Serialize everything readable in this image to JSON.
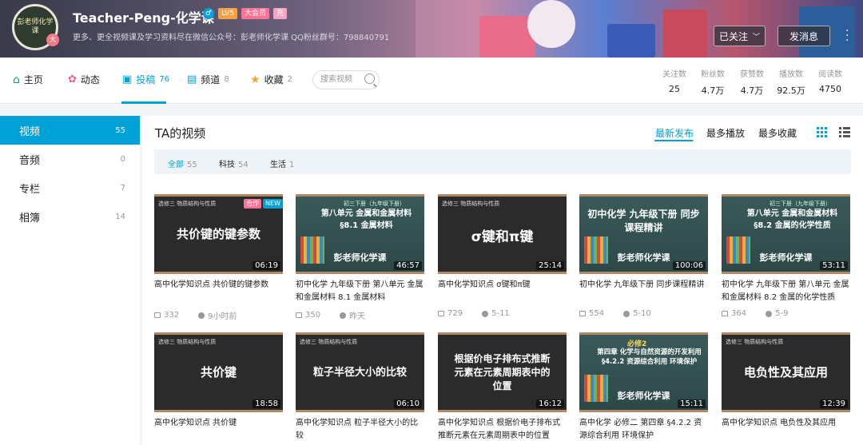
{
  "header": {
    "avatar_text": "彭老师化学课",
    "avatar_badge": "大",
    "username": "Teacher-Peng-化学课",
    "tags": [
      {
        "label": "♂",
        "color": "#00a1d6"
      },
      {
        "label": "LV5",
        "color": "#f6a144"
      },
      {
        "label": "大会员",
        "color": "#fb7299"
      },
      {
        "label": "充",
        "color": "#f3a6c1"
      }
    ],
    "sign": "更多、更全视频课及学习资料尽在微信公众号：彭老师化学课 QQ粉丝群号：798840791",
    "follow_label": "已关注",
    "message_label": "发消息"
  },
  "nav": {
    "items": [
      {
        "label": "主页",
        "count": "",
        "icon": "home-icon"
      },
      {
        "label": "动态",
        "count": "",
        "icon": "dynamic-icon"
      },
      {
        "label": "投稿",
        "count": "76",
        "icon": "upload-icon"
      },
      {
        "label": "频道",
        "count": "8",
        "icon": "channel-icon"
      },
      {
        "label": "收藏",
        "count": "2",
        "icon": "favorite-icon"
      }
    ],
    "search_placeholder": "搜索视频",
    "stats": [
      {
        "label": "关注数",
        "value": "25"
      },
      {
        "label": "粉丝数",
        "value": "4.7万"
      },
      {
        "label": "获赞数",
        "value": "4.7万"
      },
      {
        "label": "播放数",
        "value": "92.5万"
      },
      {
        "label": "阅读数",
        "value": "4750"
      }
    ]
  },
  "sidebar": {
    "items": [
      {
        "label": "视频",
        "count": "55"
      },
      {
        "label": "音频",
        "count": "0"
      },
      {
        "label": "专栏",
        "count": "7"
      },
      {
        "label": "相簿",
        "count": "14"
      }
    ]
  },
  "main": {
    "title": "TA的视频",
    "sort": [
      "最新发布",
      "最多播放",
      "最多收藏"
    ],
    "filters": [
      {
        "label": "全部",
        "count": "55"
      },
      {
        "label": "科技",
        "count": "54"
      },
      {
        "label": "生活",
        "count": "1"
      }
    ],
    "videos": [
      {
        "thumb_sub": "选修三 物质结构与性质",
        "thumb_text": "共价键的键参数",
        "duration": "06:19",
        "title": "高中化学知识点 共价键的键参数",
        "plays": "332",
        "time": "9小时前",
        "badges": [
          "合作",
          "NEW"
        ]
      },
      {
        "thumb_sub": "初三下册（九年级下册）",
        "thumb_text": "第八单元 金属和金属材料 §8.1 金属材料",
        "thumb_logo": "彭老师化学课",
        "duration": "46:57",
        "title": "初中化学 九年级下册 第八单元 金属和金属材料 8.1 金属材料",
        "plays": "350",
        "time": "昨天"
      },
      {
        "thumb_sub": "选修三 物质结构与性质",
        "thumb_text": "σ键和π键",
        "duration": "25:14",
        "title": "高中化学知识点 σ键和π键",
        "plays": "729",
        "time": "5-11"
      },
      {
        "thumb_sub": "",
        "thumb_text": "初中化学 九年级下册 同步课程精讲",
        "thumb_logo": "彭老师化学课",
        "duration": "100:06",
        "title": "初中化学 九年级下册 同步课程精讲",
        "plays": "554",
        "time": "5-10"
      },
      {
        "thumb_sub": "初三下册（九年级下册）",
        "thumb_text": "第八单元 金属和金属材料 §8.2 金属的化学性质",
        "thumb_logo": "彭老师化学课",
        "duration": "53:11",
        "title": "初中化学 九年级下册 第八单元 金属和金属材料 8.2 金属的化学性质",
        "plays": "364",
        "time": "5-9"
      },
      {
        "thumb_sub": "选修三 物质结构与性质",
        "thumb_text": "共价键",
        "duration": "18:58",
        "title": "高中化学知识点 共价键"
      },
      {
        "thumb_sub": "选修三 物质结构与性质",
        "thumb_text": "粒子半径大小的比较",
        "duration": "06:10",
        "title": "高中化学知识点 粒子半径大小的比较"
      },
      {
        "thumb_sub": "",
        "thumb_text": "根据价电子排布式推断元素在元素周期表中的位置",
        "duration": "16:12",
        "title": "高中化学知识点 根据价电子排布式推断元素在元素周期表中的位置"
      },
      {
        "thumb_sub": "必修2",
        "thumb_text": "第四章 化学与自然资源的开发利用 §4.2.2 资源综合利用 环境保护",
        "thumb_logo": "彭老师化学课",
        "duration": "15:11",
        "title": "高中化学 必修二 第四章 §4.2.2 资源综合利用 环境保护"
      },
      {
        "thumb_sub": "选修三 物质结构与性质",
        "thumb_text": "电负性及其应用",
        "duration": "12:39",
        "title": "高中化学知识点 电负性及其应用"
      }
    ]
  }
}
